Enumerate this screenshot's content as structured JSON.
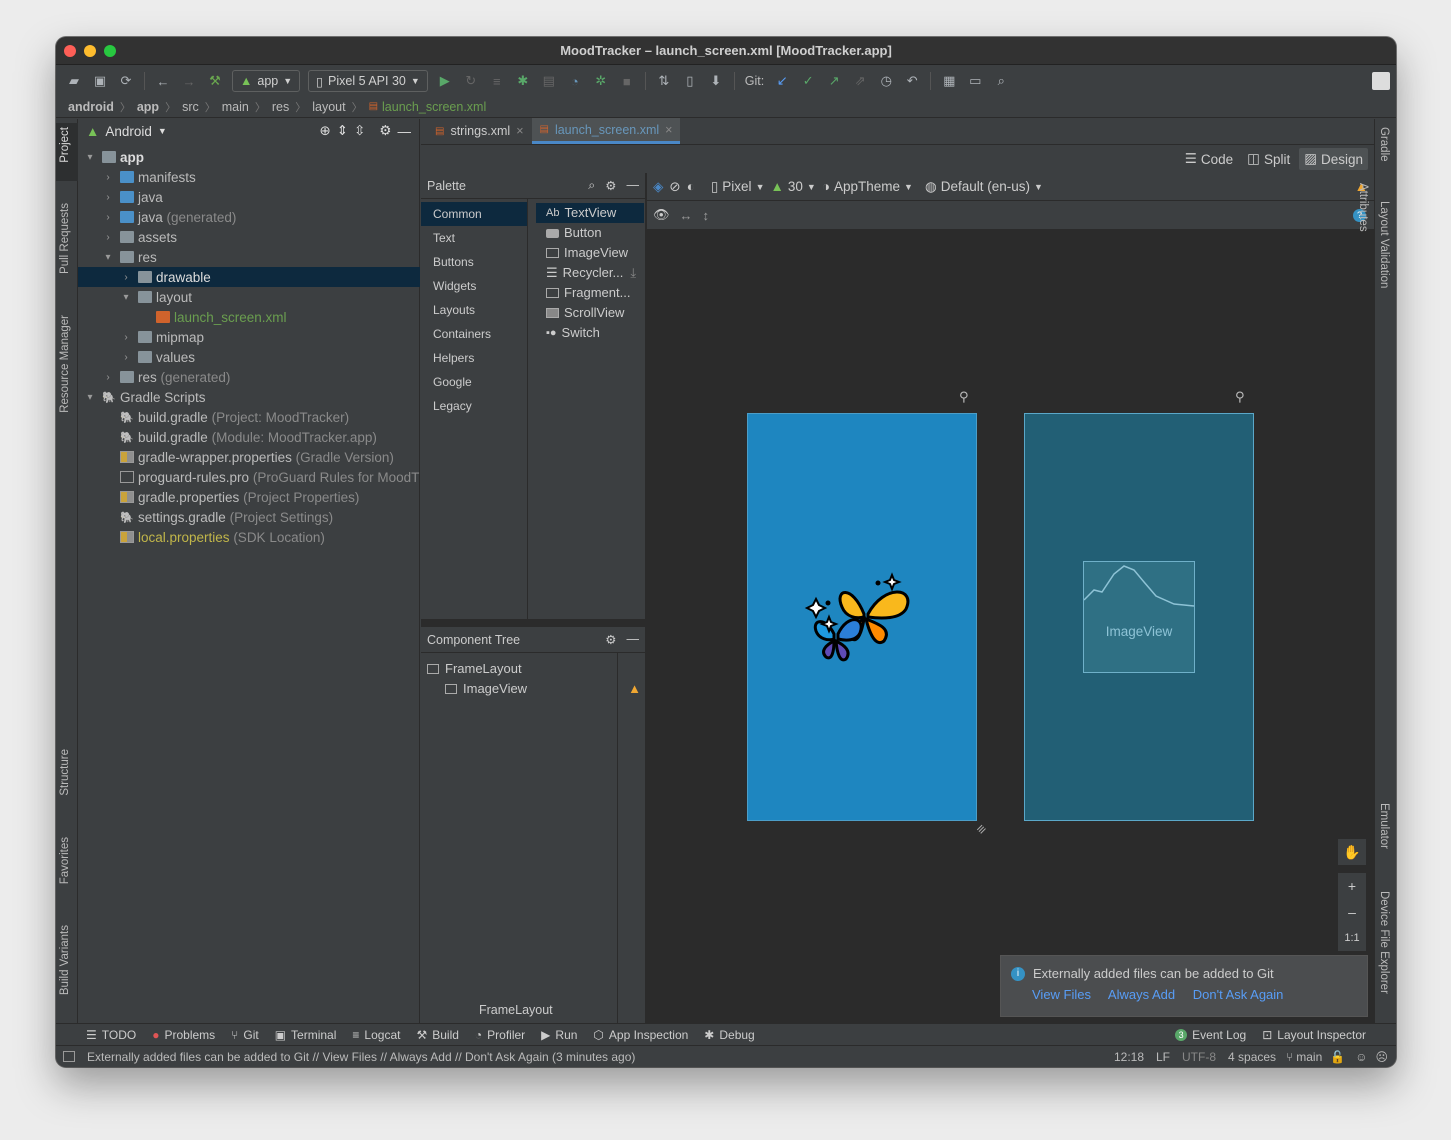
{
  "window": {
    "title": "MoodTracker – launch_screen.xml [MoodTracker.app]"
  },
  "toolbar": {
    "run_config": "app",
    "device": "Pixel 5 API 30",
    "git_label": "Git:"
  },
  "breadcrumb": [
    "android",
    "app",
    "src",
    "main",
    "res",
    "layout",
    "launch_screen.xml"
  ],
  "left_strip": [
    "Project",
    "Pull Requests",
    "Resource Manager",
    "Structure",
    "Favorites",
    "Build Variants"
  ],
  "right_strip": [
    "Gradle",
    "Layout Validation",
    "Emulator",
    "Device File Explorer"
  ],
  "project": {
    "view_selector": "Android",
    "tree": [
      {
        "label": "app",
        "suffix": ""
      },
      {
        "label": "manifests",
        "suffix": ""
      },
      {
        "label": "java",
        "suffix": ""
      },
      {
        "label": "java",
        "suffix": "(generated)"
      },
      {
        "label": "assets",
        "suffix": ""
      },
      {
        "label": "res",
        "suffix": ""
      },
      {
        "label": "drawable",
        "suffix": ""
      },
      {
        "label": "layout",
        "suffix": ""
      },
      {
        "label": "launch_screen.xml",
        "suffix": ""
      },
      {
        "label": "mipmap",
        "suffix": ""
      },
      {
        "label": "values",
        "suffix": ""
      },
      {
        "label": "res",
        "suffix": "(generated)"
      },
      {
        "label": "Gradle Scripts",
        "suffix": ""
      },
      {
        "label": "build.gradle",
        "suffix": "(Project: MoodTracker)"
      },
      {
        "label": "build.gradle",
        "suffix": "(Module: MoodTracker.app)"
      },
      {
        "label": "gradle-wrapper.properties",
        "suffix": "(Gradle Version)"
      },
      {
        "label": "proguard-rules.pro",
        "suffix": "(ProGuard Rules for MoodT"
      },
      {
        "label": "gradle.properties",
        "suffix": "(Project Properties)"
      },
      {
        "label": "settings.gradle",
        "suffix": "(Project Settings)"
      },
      {
        "label": "local.properties",
        "suffix": "(SDK Location)"
      }
    ]
  },
  "editor_tabs": [
    "strings.xml",
    "launch_screen.xml"
  ],
  "modes": [
    "Code",
    "Split",
    "Design"
  ],
  "palette": {
    "title": "Palette",
    "categories": [
      "Common",
      "Text",
      "Buttons",
      "Widgets",
      "Layouts",
      "Containers",
      "Helpers",
      "Google",
      "Legacy"
    ],
    "items": [
      "TextView",
      "Button",
      "ImageView",
      "Recycler...",
      "Fragment...",
      "ScrollView",
      "Switch"
    ],
    "textview_prefix": "Ab"
  },
  "component_tree": {
    "title": "Component Tree",
    "items": [
      "FrameLayout",
      "ImageView"
    ]
  },
  "design_toolbar": {
    "device": "Pixel",
    "api": "30",
    "theme": "AppTheme",
    "locale": "Default (en-us)"
  },
  "attributes_label": "Attributes",
  "blueprint": {
    "imageview_label": "ImageView"
  },
  "zoom": {
    "plus": "+",
    "minus": "–",
    "ratio": "1:1"
  },
  "notification": {
    "message": "Externally added files can be added to Git",
    "actions": [
      "View Files",
      "Always Add",
      "Don't Ask Again"
    ]
  },
  "breadcrumb_bottom": "FrameLayout",
  "bottom_tools": [
    "TODO",
    "Problems",
    "Git",
    "Terminal",
    "Logcat",
    "Build",
    "Profiler",
    "Run",
    "App Inspection",
    "Debug"
  ],
  "bottom_right_tools": {
    "event_count": "3",
    "event_log": "Event Log",
    "layout_inspector": "Layout Inspector"
  },
  "status": {
    "message": "Externally added files can be added to Git // View Files // Always Add // Don't Ask Again (3 minutes ago)",
    "time": "12:18",
    "line_sep": "LF",
    "encoding": "UTF-8",
    "indent": "4 spaces",
    "branch": "main"
  }
}
